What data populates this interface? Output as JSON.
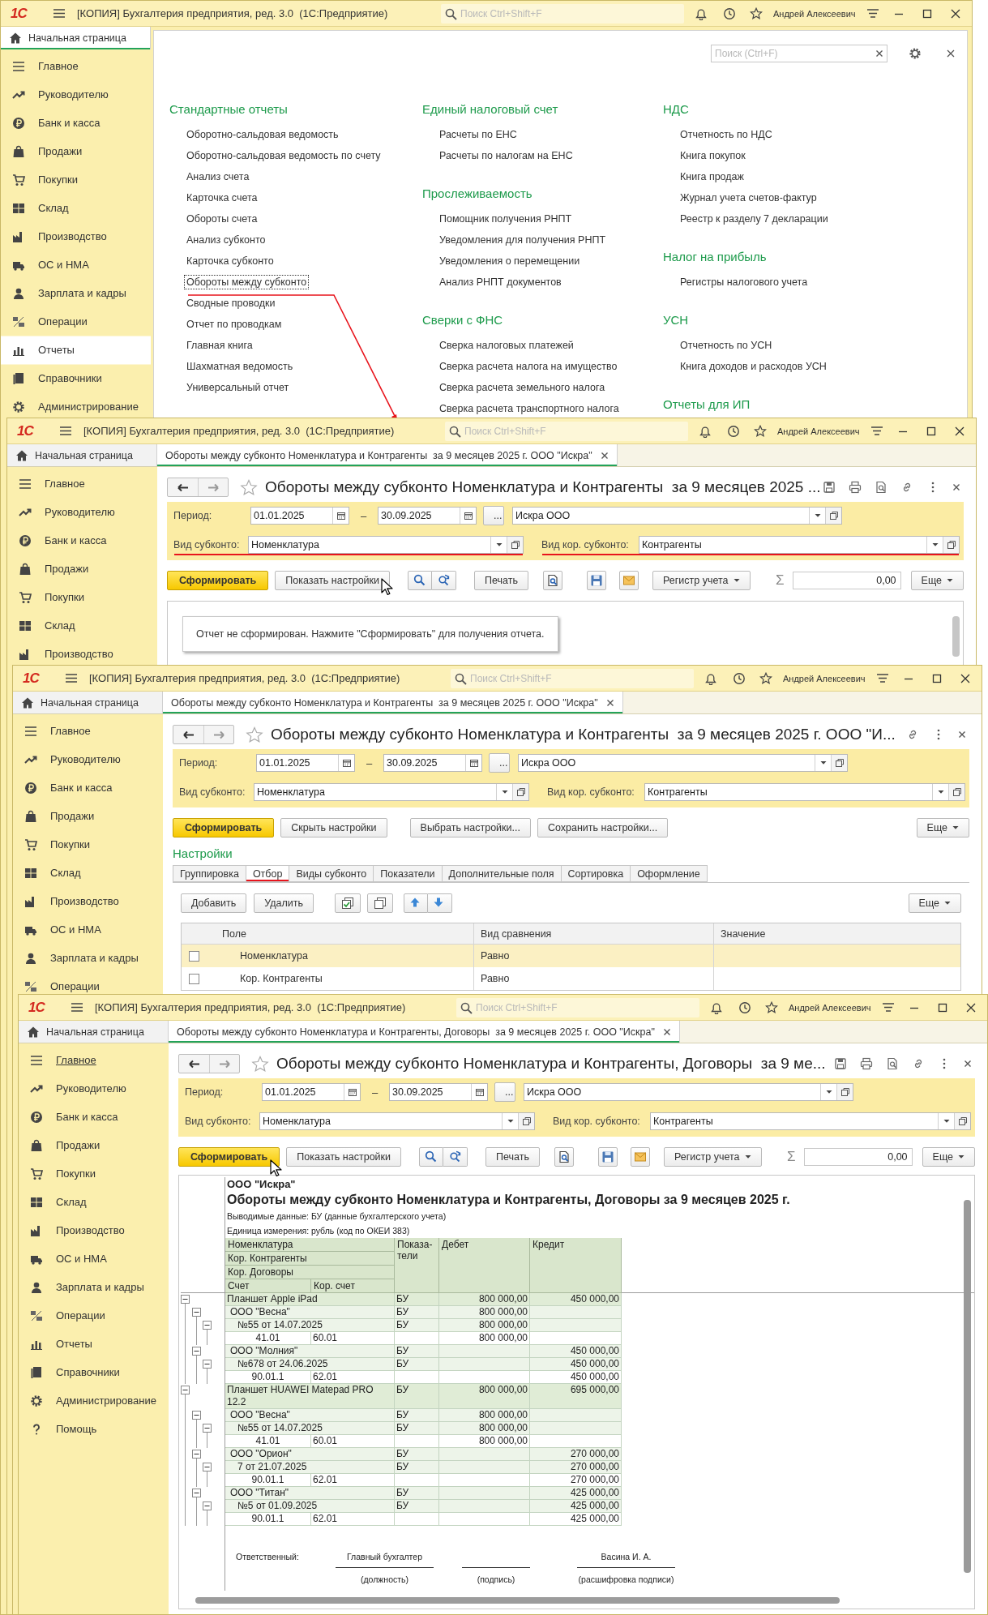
{
  "windows": [
    {
      "kind": "home",
      "logo": "1С",
      "title": "[КОПИЯ] Бухгалтерия предприятия, ред. 3.0  (1С:Предприятие)",
      "search_placeholder": "Поиск Ctrl+Shift+F",
      "user": "Андрей Алексеевич",
      "tabs": [
        {
          "kind": "home",
          "label": "Начальная страница",
          "selected": true
        }
      ],
      "sidebar": [
        {
          "label": "Главное",
          "selected": false,
          "hovered": false
        },
        {
          "label": "Руководителю",
          "selected": false,
          "hovered": false
        },
        {
          "label": "Банк и касса",
          "selected": false,
          "hovered": false
        },
        {
          "label": "Продажи",
          "selected": false,
          "hovered": false
        },
        {
          "label": "Покупки",
          "selected": false,
          "hovered": false
        },
        {
          "label": "Склад",
          "selected": false,
          "hovered": false
        },
        {
          "label": "Производство",
          "selected": false,
          "hovered": false
        },
        {
          "label": "ОС и НМА",
          "selected": false,
          "hovered": false
        },
        {
          "label": "Зарплата и кадры",
          "selected": false,
          "hovered": false
        },
        {
          "label": "Операции",
          "selected": false,
          "hovered": false
        },
        {
          "label": "Отчеты",
          "selected": true,
          "hovered": false
        },
        {
          "label": "Справочники",
          "selected": false,
          "hovered": false
        },
        {
          "label": "Администрирование",
          "selected": false,
          "hovered": false
        }
      ],
      "panel": {
        "search_placeholder": "Поиск (Ctrl+F)",
        "columns": [
          {
            "sections": [
              {
                "title": "Стандартные отчеты",
                "links": [
                  {
                    "label": "Оборотно-сальдовая ведомость",
                    "focused": false
                  },
                  {
                    "label": "Оборотно-сальдовая ведомость по счету",
                    "focused": false
                  },
                  {
                    "label": "Анализ счета",
                    "focused": false
                  },
                  {
                    "label": "Карточка счета",
                    "focused": false
                  },
                  {
                    "label": "Обороты счета",
                    "focused": false
                  },
                  {
                    "label": "Анализ субконто",
                    "focused": false
                  },
                  {
                    "label": "Карточка субконто",
                    "focused": false
                  },
                  {
                    "label": "Обороты между субконто",
                    "focused": true
                  },
                  {
                    "label": "Сводные проводки",
                    "focused": false
                  },
                  {
                    "label": "Отчет по проводкам",
                    "focused": false
                  },
                  {
                    "label": "Главная книга",
                    "focused": false
                  },
                  {
                    "label": "Шахматная ведомость",
                    "focused": false
                  },
                  {
                    "label": "Универсальный отчет",
                    "focused": false
                  }
                ]
              }
            ]
          },
          {
            "sections": [
              {
                "title": "Единый налоговый счет",
                "links": [
                  {
                    "label": "Расчеты по ЕНС",
                    "focused": false
                  },
                  {
                    "label": "Расчеты по налогам на ЕНС",
                    "focused": false
                  }
                ]
              },
              {
                "title": "Прослеживаемость",
                "links": [
                  {
                    "label": "Помощник получения РНПТ",
                    "focused": false
                  },
                  {
                    "label": "Уведомления для получения РНПТ",
                    "focused": false
                  },
                  {
                    "label": "Уведомления о перемещении",
                    "focused": false
                  },
                  {
                    "label": "Анализ РНПТ документов",
                    "focused": false
                  }
                ]
              },
              {
                "title": "Сверки с ФНС",
                "links": [
                  {
                    "label": "Сверка налоговых платежей",
                    "focused": false
                  },
                  {
                    "label": "Сверка расчета налога на имущество",
                    "focused": false
                  },
                  {
                    "label": "Сверка расчета земельного налога",
                    "focused": false
                  },
                  {
                    "label": "Сверка расчета транспортного налога",
                    "focused": false
                  }
                ]
              }
            ]
          },
          {
            "sections": [
              {
                "title": "НДС",
                "links": [
                  {
                    "label": "Отчетность по НДС",
                    "focused": false
                  },
                  {
                    "label": "Книга покупок",
                    "focused": false
                  },
                  {
                    "label": "Книга продаж",
                    "focused": false
                  },
                  {
                    "label": "Журнал учета счетов-фактур",
                    "focused": false
                  },
                  {
                    "label": "Реестр к разделу 7 декларации",
                    "focused": false
                  }
                ]
              },
              {
                "title": "Налог на прибыль",
                "links": [
                  {
                    "label": "Регистры налогового учета",
                    "focused": false
                  }
                ]
              },
              {
                "title": "УСН",
                "links": [
                  {
                    "label": "Отчетность по УСН",
                    "focused": false
                  },
                  {
                    "label": "Книга доходов и расходов УСН",
                    "focused": false
                  }
                ]
              },
              {
                "title": "Отчеты для ИП"
              }
            ]
          }
        ]
      }
    },
    {
      "kind": "form",
      "logo": "1С",
      "title": "[КОПИЯ] Бухгалтерия предприятия, ред. 3.0  (1С:Предприятие)",
      "search_placeholder": "Поиск Ctrl+Shift+F",
      "user": "Андрей Алексеевич",
      "tabs": [
        {
          "kind": "home",
          "label": "Начальная страница",
          "selected": false
        },
        {
          "kind": "document",
          "label": "Обороты между субконто Номенклатура и Контрагенты  за 9 месяцев 2025 г. ООО \"Искра\"",
          "selected": true
        }
      ],
      "sidebar": [
        {
          "label": "Главное",
          "selected": false,
          "hovered": false
        },
        {
          "label": "Руководителю",
          "selected": false,
          "hovered": false
        },
        {
          "label": "Банк и касса",
          "selected": false,
          "hovered": false
        },
        {
          "label": "Продажи",
          "selected": false,
          "hovered": false
        },
        {
          "label": "Покупки",
          "selected": false,
          "hovered": false
        },
        {
          "label": "Склад",
          "selected": false,
          "hovered": false
        },
        {
          "label": "Производство",
          "selected": false,
          "hovered": false
        }
      ],
      "form": {
        "kind": "report",
        "title": "Обороты между субконто Номенклатура и Контрагенты  за 9 месяцев 2025 ...",
        "filters": {
          "period_label": "Период:",
          "date_from": "01.01.2025",
          "dash": "–",
          "date_to": "30.09.2025",
          "period_button": "...",
          "organization": "Искра ООО",
          "subkonto_label": "Вид субконто:",
          "subkonto": "Номенклатура",
          "corr_label": "Вид кор. субконто:",
          "corr_subkonto": "Контрагенты",
          "highlighted": true
        },
        "toolbar": [
          {
            "kind": "primary",
            "label": "Сформировать"
          },
          {
            "kind": "button",
            "label": "Показать настройки"
          },
          {
            "kind": "search_pair"
          },
          {
            "kind": "button",
            "label": "Печать"
          },
          {
            "kind": "preview"
          },
          {
            "kind": "save"
          },
          {
            "kind": "mail"
          },
          {
            "kind": "dropdown",
            "label": "Регистр учета"
          },
          {
            "kind": "sum",
            "sign": "Σ",
            "value": "0,00"
          },
          {
            "kind": "dropdown",
            "label": "Еще"
          }
        ],
        "body": {
          "kind": "message",
          "text": "Отчет не сформирован. Нажмите \"Сформировать\" для получения отчета."
        }
      }
    },
    {
      "kind": "form",
      "logo": "1С",
      "title": "[КОПИЯ] Бухгалтерия предприятия, ред. 3.0  (1С:Предприятие)",
      "search_placeholder": "Поиск Ctrl+Shift+F",
      "user": "Андрей Алексеевич",
      "tabs": [
        {
          "kind": "home",
          "label": "Начальная страница",
          "selected": false
        },
        {
          "kind": "document",
          "label": "Обороты между субконто Номенклатура и Контрагенты  за 9 месяцев 2025 г. ООО \"Искра\"",
          "selected": true
        }
      ],
      "sidebar": [
        {
          "label": "Главное",
          "selected": false,
          "hovered": false
        },
        {
          "label": "Руководителю",
          "selected": false,
          "hovered": false
        },
        {
          "label": "Банк и касса",
          "selected": false,
          "hovered": false
        },
        {
          "label": "Продажи",
          "selected": false,
          "hovered": false
        },
        {
          "label": "Покупки",
          "selected": false,
          "hovered": false
        },
        {
          "label": "Склад",
          "selected": false,
          "hovered": false
        },
        {
          "label": "Производство",
          "selected": false,
          "hovered": false
        },
        {
          "label": "ОС и НМА",
          "selected": false,
          "hovered": false
        },
        {
          "label": "Зарплата и кадры",
          "selected": false,
          "hovered": false
        },
        {
          "label": "Операции",
          "selected": false,
          "hovered": false
        }
      ],
      "form": {
        "kind": "settings",
        "title": "Обороты между субконто Номенклатура и Контрагенты  за 9 месяцев 2025 г. ООО \"И...",
        "filters": {
          "period_label": "Период:",
          "date_from": "01.01.2025",
          "dash": "–",
          "date_to": "30.09.2025",
          "period_button": "...",
          "organization": "Искра ООО",
          "subkonto_label": "Вид субконто:",
          "subkonto": "Номенклатура",
          "corr_label": "Вид кор. субконто:",
          "corr_subkonto": "Контрагенты",
          "highlighted": false
        },
        "toolbar": [
          {
            "kind": "primary",
            "label": "Сформировать"
          },
          {
            "kind": "button",
            "label": "Скрыть настройки"
          },
          {
            "kind": "button",
            "label": "Выбрать настройки..."
          },
          {
            "kind": "button",
            "label": "Сохранить настройки..."
          },
          {
            "kind": "dropdown",
            "label": "Еще"
          }
        ],
        "body": {
          "kind": "settings",
          "heading": "Настройки",
          "tabs": [
            {
              "label": "Группировка",
              "selected": false
            },
            {
              "label": "Отбор",
              "selected": true
            },
            {
              "label": "Виды субконто",
              "selected": false
            },
            {
              "label": "Показатели",
              "selected": false
            },
            {
              "label": "Дополнительные поля",
              "selected": false
            },
            {
              "label": "Сортировка",
              "selected": false
            },
            {
              "label": "Оформление",
              "selected": false
            }
          ],
          "buttons": [
            {
              "kind": "button",
              "label": "Добавить"
            },
            {
              "kind": "button",
              "label": "Удалить"
            },
            {
              "kind": "check_all"
            },
            {
              "kind": "copy"
            },
            {
              "kind": "up"
            },
            {
              "kind": "down"
            },
            {
              "kind": "dropdown",
              "label": "Еще"
            }
          ],
          "columns": [
            "Поле",
            "Вид сравнения",
            "Значение"
          ],
          "rows": [
            {
              "checked": false,
              "field": "Номенклатура",
              "comparison": "Равно",
              "selected": true
            },
            {
              "checked": false,
              "field": "Кор. Контрагенты",
              "comparison": "Равно",
              "selected": false
            }
          ]
        }
      }
    },
    {
      "kind": "form",
      "logo": "1С",
      "title": "[КОПИЯ] Бухгалтерия предприятия, ред. 3.0  (1С:Предприятие)",
      "search_placeholder": "Поиск Ctrl+Shift+F",
      "user": "Андрей Алексеевич",
      "tabs": [
        {
          "kind": "home",
          "label": "Начальная страница",
          "selected": false
        },
        {
          "kind": "document",
          "label": "Обороты между субконто Номенклатура и Контрагенты, Договоры  за 9 месяцев 2025 г. ООО \"Искра\"",
          "selected": true
        }
      ],
      "sidebar": [
        {
          "label": "Главное",
          "selected": false,
          "hovered": true
        },
        {
          "label": "Руководителю",
          "selected": false,
          "hovered": false
        },
        {
          "label": "Банк и касса",
          "selected": false,
          "hovered": false
        },
        {
          "label": "Продажи",
          "selected": false,
          "hovered": false
        },
        {
          "label": "Покупки",
          "selected": false,
          "hovered": false
        },
        {
          "label": "Склад",
          "selected": false,
          "hovered": false
        },
        {
          "label": "Производство",
          "selected": false,
          "hovered": false
        },
        {
          "label": "ОС и НМА",
          "selected": false,
          "hovered": false
        },
        {
          "label": "Зарплата и кадры",
          "selected": false,
          "hovered": false
        },
        {
          "label": "Операции",
          "selected": false,
          "hovered": false
        },
        {
          "label": "Отчеты",
          "selected": false,
          "hovered": false
        },
        {
          "label": "Справочники",
          "selected": false,
          "hovered": false
        },
        {
          "label": "Администрирование",
          "selected": false,
          "hovered": false
        },
        {
          "label": "Помощь",
          "selected": false,
          "hovered": false
        }
      ],
      "form": {
        "kind": "report",
        "title": "Обороты между субконто Номенклатура и Контрагенты, Договоры  за 9 ме...",
        "filters": {
          "period_label": "Период:",
          "date_from": "01.01.2025",
          "dash": "–",
          "date_to": "30.09.2025",
          "period_button": "...",
          "organization": "Искра ООО",
          "subkonto_label": "Вид субконто:",
          "subkonto": "Номенклатура",
          "corr_label": "Вид кор. субконто:",
          "corr_subkonto": "Контрагенты",
          "highlighted": false
        },
        "toolbar": [
          {
            "kind": "primary",
            "label": "Сформировать"
          },
          {
            "kind": "button",
            "label": "Показать настройки"
          },
          {
            "kind": "search_pair"
          },
          {
            "kind": "button",
            "label": "Печать"
          },
          {
            "kind": "preview"
          },
          {
            "kind": "save"
          },
          {
            "kind": "mail"
          },
          {
            "kind": "dropdown",
            "label": "Регистр учета"
          },
          {
            "kind": "sum",
            "sign": "Σ",
            "value": "0,00"
          },
          {
            "kind": "dropdown",
            "label": "Еще"
          }
        ],
        "body": {
          "kind": "report",
          "organization": "ООО \"Искра\"",
          "title": "Обороты между субконто Номенклатура и Контрагенты, Договоры за 9 месяцев 2025 г.",
          "notes": [
            "Выводимые данные: БУ (данные бухгалтерского учета)",
            "Единица измерения: рубль (код по ОКЕИ 383)"
          ],
          "header": {
            "levels": [
              "Номенклатура",
              "Кор. Контрагенты",
              "Кор. Договоры"
            ],
            "account": "Счет",
            "corr_account": "Кор. счет",
            "indicator": "Показа-тели",
            "debit": "Дебет",
            "credit": "Кредит"
          },
          "rows": [
            {
              "name": "Планшет Apple iPad",
              "indicator": "БУ",
              "debit": "800 000,00",
              "credit": "450 000,00",
              "expanded": true,
              "children": [
                {
                  "name": "ООО \"Весна\"",
                  "indicator": "БУ",
                  "debit": "800 000,00",
                  "expanded": true,
                  "children": [
                    {
                      "name": "№55 от 14.07.2025",
                      "indicator": "БУ",
                      "debit": "800 000,00",
                      "expanded": true,
                      "children": [
                        {
                          "account": "41.01",
                          "corr_account": "60.01",
                          "debit": "800 000,00"
                        }
                      ]
                    }
                  ]
                },
                {
                  "name": "ООО \"Молния\"",
                  "indicator": "БУ",
                  "credit": "450 000,00",
                  "expanded": true,
                  "children": [
                    {
                      "name": "№678 от 24.06.2025",
                      "indicator": "БУ",
                      "credit": "450 000,00",
                      "expanded": true,
                      "children": [
                        {
                          "account": "90.01.1",
                          "corr_account": "62.01",
                          "credit": "450 000,00"
                        }
                      ]
                    }
                  ]
                }
              ]
            },
            {
              "name": "Планшет HUAWEI Matepad PRO 12.2",
              "indicator": "БУ",
              "debit": "800 000,00",
              "credit": "695 000,00",
              "expanded": true,
              "children": [
                {
                  "name": "ООО \"Весна\"",
                  "indicator": "БУ",
                  "debit": "800 000,00",
                  "expanded": true,
                  "children": [
                    {
                      "name": "№55 от 14.07.2025",
                      "indicator": "БУ",
                      "debit": "800 000,00",
                      "expanded": true,
                      "children": [
                        {
                          "account": "41.01",
                          "corr_account": "60.01",
                          "debit": "800 000,00"
                        }
                      ]
                    }
                  ]
                },
                {
                  "name": "ООО \"Орион\"",
                  "indicator": "БУ",
                  "credit": "270 000,00",
                  "expanded": true,
                  "children": [
                    {
                      "name": "7 от 21.07.2025",
                      "indicator": "БУ",
                      "credit": "270 000,00",
                      "expanded": true,
                      "children": [
                        {
                          "account": "90.01.1",
                          "corr_account": "62.01",
                          "credit": "270 000,00"
                        }
                      ]
                    }
                  ]
                },
                {
                  "name": "ООО \"Титан\"",
                  "indicator": "БУ",
                  "credit": "425 000,00",
                  "expanded": true,
                  "children": [
                    {
                      "name": "№5 от 01.09.2025",
                      "indicator": "БУ",
                      "credit": "425 000,00",
                      "expanded": true,
                      "children": [
                        {
                          "account": "90.01.1",
                          "corr_account": "62.01",
                          "credit": "425 000,00"
                        }
                      ]
                    }
                  ]
                }
              ]
            }
          ],
          "signature": {
            "label": "Ответственный:",
            "position": "Главный бухгалтер",
            "position_caption": "(должность)",
            "signature_caption": "(подпись)",
            "name": "Васина И. А.",
            "name_caption": "(расшифровка подписи)"
          }
        }
      }
    }
  ]
}
